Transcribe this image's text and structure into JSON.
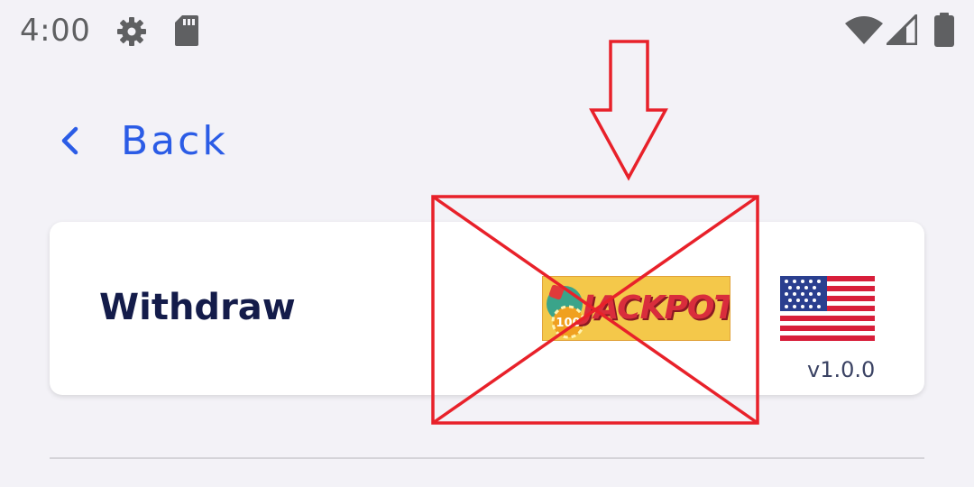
{
  "status_bar": {
    "time": "4:00",
    "left_icons": [
      "gear-icon",
      "sd-card-icon"
    ],
    "right_icons": [
      "wifi-icon",
      "cellular-signal-icon",
      "battery-icon"
    ]
  },
  "nav": {
    "back_label": "Back",
    "back_icon": "chevron-left-icon"
  },
  "card": {
    "title": "Withdraw",
    "banner_text": "JACKPOT",
    "banner_badge": "100",
    "flag_icon": "us-flag-icon",
    "version": "v1.0.0"
  },
  "colors": {
    "background": "#f3f2f7",
    "accent": "#2b5ce6",
    "title": "#141c4a",
    "annotation": "#e8212a"
  }
}
